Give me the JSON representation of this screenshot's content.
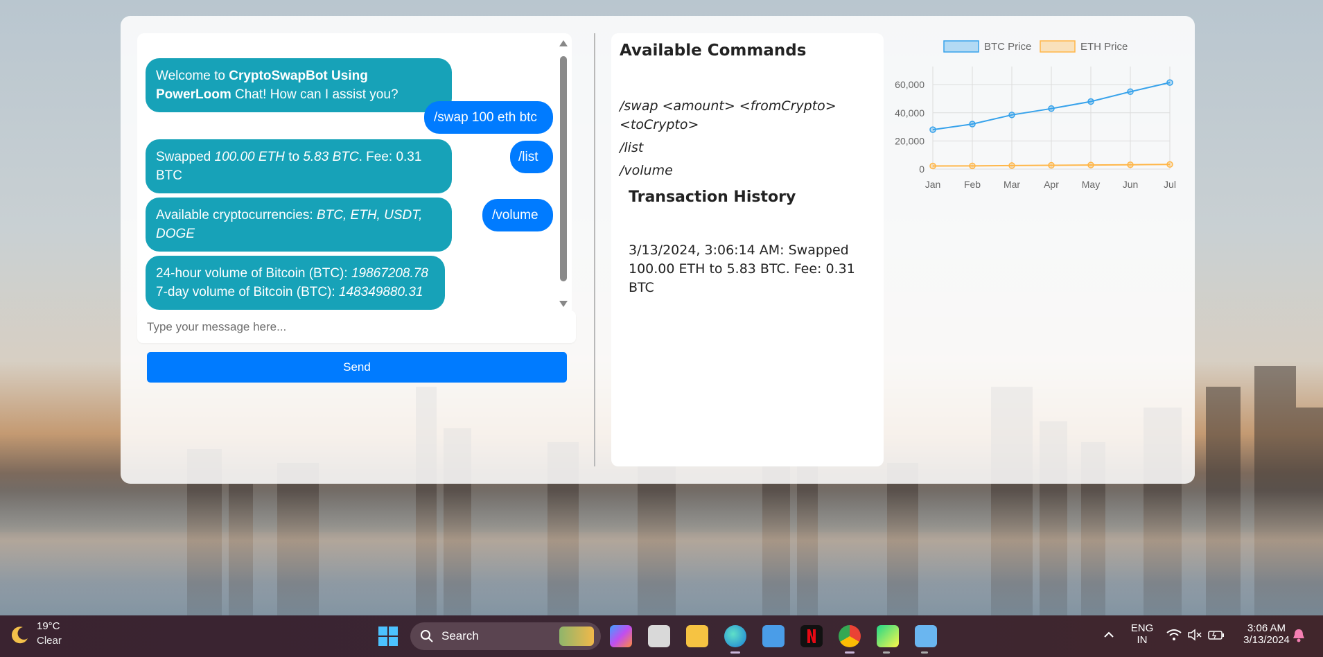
{
  "chat": {
    "messages": [
      {
        "sender": "bot",
        "text_pre": "Welcome to ",
        "text_bold": "CryptoSwapBot Using PowerLoom",
        "text_post": " Chat! How can I assist you?"
      },
      {
        "sender": "user",
        "text": "/swap 100 eth btc"
      },
      {
        "sender": "user",
        "text": "/list"
      },
      {
        "sender": "bot",
        "prefix": "Swapped ",
        "amount_from": "100.00 ETH",
        "mid": " to ",
        "amount_to": "5.83 BTC",
        "suffix": ". Fee: 0.31 BTC"
      },
      {
        "sender": "user",
        "text": "/volume"
      },
      {
        "sender": "bot",
        "prefix": "Available cryptocurrencies: ",
        "list": "BTC, ETH, USDT, DOGE"
      },
      {
        "sender": "bot",
        "line1_prefix": "24-hour volume of Bitcoin (BTC): ",
        "line1_value": "19867208.78",
        "line2_prefix": "7-day volume of Bitcoin (BTC): ",
        "line2_value": "148349880.31"
      }
    ],
    "input_placeholder": "Type your message here...",
    "input_value": "",
    "send_label": "Send"
  },
  "commands": {
    "title": "Available Commands",
    "items": [
      "/swap <amount> <fromCrypto> <toCrypto>",
      "/list",
      "/volume"
    ]
  },
  "history": {
    "title": "Transaction History",
    "entries": [
      "3/13/2024, 3:06:14 AM: Swapped 100.00 ETH to 5.83 BTC. Fee: 0.31 BTC"
    ]
  },
  "chart_data": {
    "type": "line",
    "categories": [
      "Jan",
      "Feb",
      "Mar",
      "Apr",
      "May",
      "Jun",
      "Jul"
    ],
    "series": [
      {
        "name": "BTC Price",
        "values": [
          28000,
          32000,
          38500,
          43000,
          48000,
          55000,
          61500
        ],
        "color": "#36a2eb"
      },
      {
        "name": "ETH Price",
        "values": [
          2200,
          2300,
          2500,
          2700,
          2900,
          3100,
          3300
        ],
        "color": "#ffb648"
      }
    ],
    "yticks": [
      0,
      20000,
      40000,
      60000
    ],
    "ytick_labels": [
      "0",
      "20,000",
      "40,000",
      "60,000"
    ],
    "ylim": [
      0,
      65000
    ],
    "grid": true,
    "legend": "top",
    "title": "",
    "xlabel": "",
    "ylabel": ""
  },
  "taskbar": {
    "weather_temp": "19°C",
    "weather_cond": "Clear",
    "search_label": "Search",
    "lang_line1": "ENG",
    "lang_line2": "IN",
    "time": "3:06 AM",
    "date": "3/13/2024"
  }
}
